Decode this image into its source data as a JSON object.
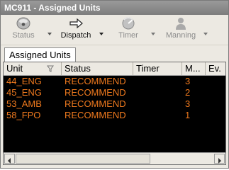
{
  "window": {
    "title": "MC911 - Assigned Units"
  },
  "toolbar": {
    "buttons": [
      {
        "label": "Status",
        "icon": "status-disc-icon",
        "enabled": false
      },
      {
        "label": "Dispatch",
        "icon": "right-arrow-icon",
        "enabled": true
      },
      {
        "label": "Timer",
        "icon": "timer-icon",
        "enabled": false
      },
      {
        "label": "Manning",
        "icon": "person-icon",
        "enabled": false
      }
    ]
  },
  "tabs": [
    {
      "label": "Assigned Units",
      "active": true
    }
  ],
  "grid": {
    "columns": [
      "Unit",
      "Status",
      "Timer",
      "M...",
      "Ev."
    ],
    "sort_icon": "funnel-filter-icon",
    "rows": [
      {
        "unit": "44_ENG",
        "status": "RECOMMEND",
        "timer": "",
        "manning": "3",
        "ev": ""
      },
      {
        "unit": "45_ENG",
        "status": "RECOMMEND",
        "timer": "",
        "manning": "2",
        "ev": ""
      },
      {
        "unit": "53_AMB",
        "status": "RECOMMEND",
        "timer": "",
        "manning": "3",
        "ev": ""
      },
      {
        "unit": "58_FPO",
        "status": "RECOMMEND",
        "timer": "",
        "manning": "1",
        "ev": ""
      }
    ],
    "row_text_color": "#f07a1e",
    "background_color": "#000000"
  }
}
